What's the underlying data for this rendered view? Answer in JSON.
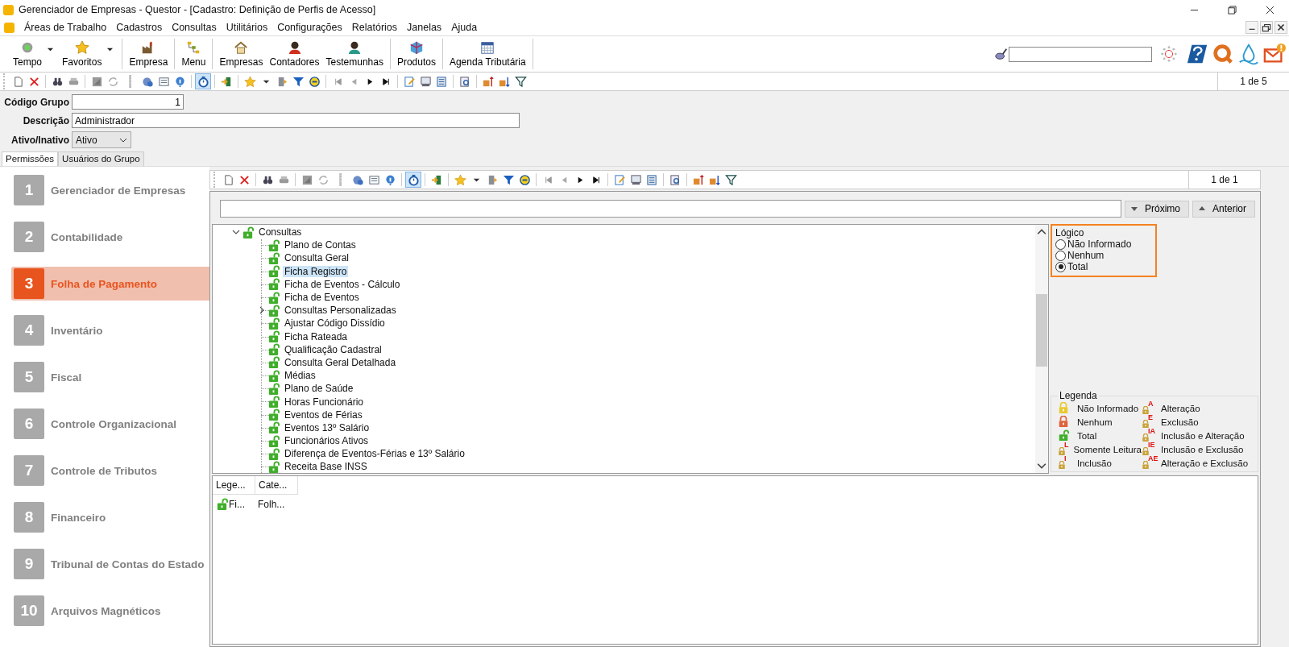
{
  "window": {
    "title": "Gerenciador de Empresas - Questor - [Cadastro: Definição de Perfis de Acesso]"
  },
  "menu": [
    "Áreas de Trabalho",
    "Cadastros",
    "Consultas",
    "Utilitários",
    "Configurações",
    "Relatórios",
    "Janelas",
    "Ajuda"
  ],
  "toolbar_groups": [
    [
      {
        "label": "Tempo",
        "dropdown": true
      },
      {
        "label": "Favoritos",
        "dropdown": true
      }
    ],
    [
      {
        "label": "Empresa",
        "dropdown": false
      }
    ],
    [
      {
        "label": "Menu",
        "dropdown": false
      }
    ],
    [
      {
        "label": "Empresas",
        "dropdown": false
      },
      {
        "label": "Contadores",
        "dropdown": false
      },
      {
        "label": "Testemunhas",
        "dropdown": false
      }
    ],
    [
      {
        "label": "Produtos",
        "dropdown": false
      }
    ],
    [
      {
        "label": "Agenda Tributária",
        "dropdown": false
      }
    ]
  ],
  "record_toolbar": {
    "counter": "1 de 5",
    "timer_pressed": true
  },
  "form": {
    "codigo_label": "Código Grupo",
    "codigo_value": "1",
    "descricao_label": "Descrição",
    "descricao_value": "Administrador",
    "ativo_label": "Ativo/Inativo",
    "ativo_value": "Ativo"
  },
  "tabs": [
    {
      "label": "Permissões",
      "selected": true
    },
    {
      "label": "Usuários do Grupo",
      "selected": false
    }
  ],
  "modules": [
    {
      "number": "1",
      "label": "Gerenciador de Empresas",
      "selected": false
    },
    {
      "number": "2",
      "label": "Contabilidade",
      "selected": false
    },
    {
      "number": "3",
      "label": "Folha de Pagamento",
      "selected": true
    },
    {
      "number": "4",
      "label": "Inventário",
      "selected": false
    },
    {
      "number": "5",
      "label": "Fiscal",
      "selected": false
    },
    {
      "number": "6",
      "label": "Controle Organizacional",
      "selected": false
    },
    {
      "number": "7",
      "label": "Controle de Tributos",
      "selected": false
    },
    {
      "number": "8",
      "label": "Financeiro",
      "selected": false
    },
    {
      "number": "9",
      "label": "Tribunal de Contas do Estado",
      "selected": false
    },
    {
      "number": "10",
      "label": "Arquivos Magnéticos",
      "selected": false
    }
  ],
  "inner_toolbar": {
    "counter": "1 de 1",
    "timer_pressed": true
  },
  "find": {
    "next": "Próximo",
    "previous": "Anterior"
  },
  "tree": [
    {
      "label": "Consultas",
      "expanded": true,
      "selected": false,
      "children": [
        {
          "label": "Plano de Contas",
          "selected": false
        },
        {
          "label": "Consulta Geral",
          "selected": false
        },
        {
          "label": "Ficha Registro",
          "selected": true
        },
        {
          "label": "Ficha de Eventos - Cálculo",
          "selected": false
        },
        {
          "label": "Ficha de Eventos",
          "selected": false
        },
        {
          "label": "Consultas Personalizadas",
          "selected": false,
          "expanded": false
        },
        {
          "label": "Ajustar Código Dissídio",
          "selected": false
        },
        {
          "label": "Ficha Rateada",
          "selected": false
        },
        {
          "label": "Qualificação Cadastral",
          "selected": false
        },
        {
          "label": "Consulta Geral Detalhada",
          "selected": false
        },
        {
          "label": "Médias",
          "selected": false
        },
        {
          "label": "Plano de Saúde",
          "selected": false
        },
        {
          "label": "Horas Funcionário",
          "selected": false
        },
        {
          "label": "Eventos de Férias",
          "selected": false
        },
        {
          "label": "Eventos 13º Salário",
          "selected": false
        },
        {
          "label": "Funcionários Ativos",
          "selected": false
        },
        {
          "label": "Diferença de Eventos-Férias e 13º Salário",
          "selected": false
        },
        {
          "label": "Receita Base INSS",
          "selected": false
        }
      ]
    }
  ],
  "logico": {
    "title": "Lógico",
    "highlighted": true,
    "options": [
      {
        "label": "Não Informado",
        "selected": false
      },
      {
        "label": "Nenhum",
        "selected": false
      },
      {
        "label": "Total",
        "selected": true
      }
    ]
  },
  "legend": {
    "title": "Legenda",
    "items": [
      {
        "label": "Não Informado",
        "kind": "yellow"
      },
      {
        "label": "Alteração",
        "kind": "small",
        "mark": "A"
      },
      {
        "label": "Nenhum",
        "kind": "red"
      },
      {
        "label": "Exclusão",
        "kind": "small",
        "mark": "E"
      },
      {
        "label": "Total",
        "kind": "green"
      },
      {
        "label": "Inclusão e Alteração",
        "kind": "small",
        "mark": "IA"
      },
      {
        "label": "Somente Leitura",
        "kind": "small",
        "mark": "L"
      },
      {
        "label": "Inclusão e Exclusão",
        "kind": "small",
        "mark": "IE"
      },
      {
        "label": "Inclusão",
        "kind": "small",
        "mark": "I"
      },
      {
        "label": "Alteração e Exclusão",
        "kind": "small",
        "mark": "AE"
      }
    ]
  },
  "list": {
    "columns": [
      "Lege...",
      "Cate..."
    ],
    "rows": [
      [
        "Fi...",
        "Folh..."
      ]
    ]
  }
}
